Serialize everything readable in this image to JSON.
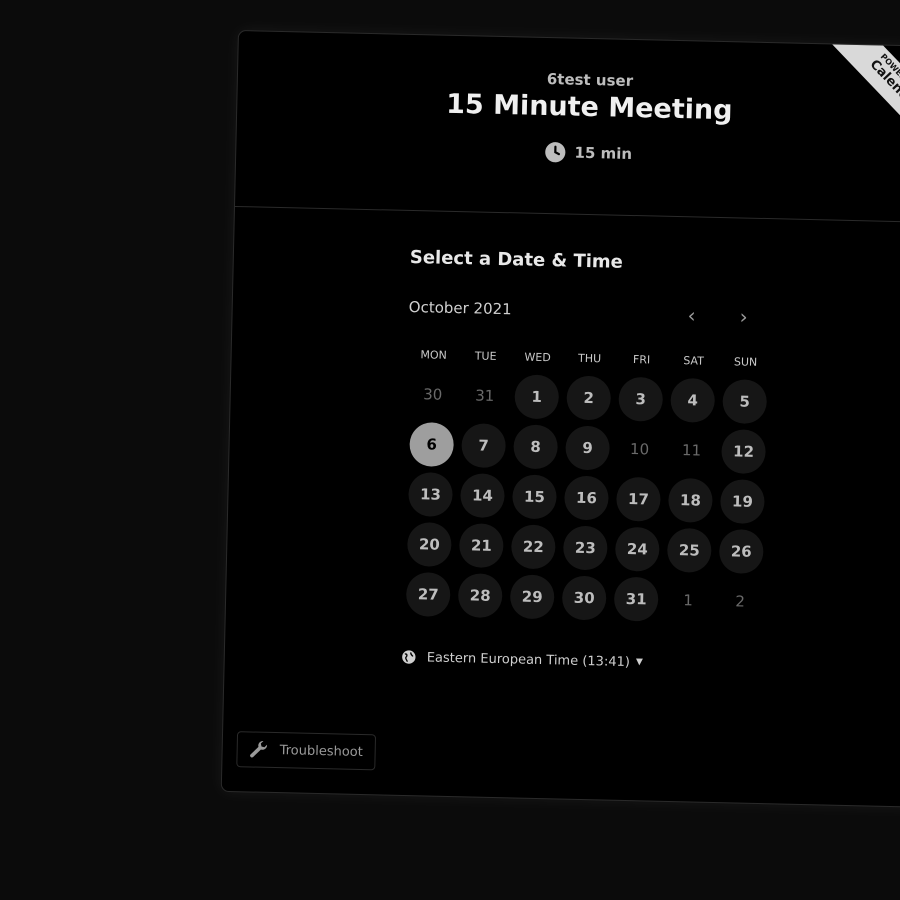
{
  "header": {
    "host_name": "6test user",
    "meeting_title": "15 Minute Meeting",
    "duration": "15 min",
    "duration_icon": "clock-icon"
  },
  "ribbon": {
    "small_text": "POWERED BY",
    "big_text": "Calendly"
  },
  "scheduler": {
    "section_title": "Select a Date & Time",
    "month_label": "October 2021",
    "prev_icon": "chevron-left-icon",
    "next_icon": "chevron-right-icon",
    "weekdays": [
      "MON",
      "TUE",
      "WED",
      "THU",
      "FRI",
      "SAT",
      "SUN"
    ],
    "days": [
      {
        "label": "30",
        "state": "unavailable"
      },
      {
        "label": "31",
        "state": "unavailable"
      },
      {
        "label": "1",
        "state": "available"
      },
      {
        "label": "2",
        "state": "available"
      },
      {
        "label": "3",
        "state": "available"
      },
      {
        "label": "4",
        "state": "available"
      },
      {
        "label": "5",
        "state": "available"
      },
      {
        "label": "6",
        "state": "selected"
      },
      {
        "label": "7",
        "state": "available"
      },
      {
        "label": "8",
        "state": "available"
      },
      {
        "label": "9",
        "state": "available"
      },
      {
        "label": "10",
        "state": "unavailable"
      },
      {
        "label": "11",
        "state": "unavailable"
      },
      {
        "label": "12",
        "state": "available"
      },
      {
        "label": "13",
        "state": "available"
      },
      {
        "label": "14",
        "state": "available"
      },
      {
        "label": "15",
        "state": "available"
      },
      {
        "label": "16",
        "state": "available"
      },
      {
        "label": "17",
        "state": "available"
      },
      {
        "label": "18",
        "state": "available"
      },
      {
        "label": "19",
        "state": "available"
      },
      {
        "label": "20",
        "state": "available"
      },
      {
        "label": "21",
        "state": "available"
      },
      {
        "label": "22",
        "state": "available"
      },
      {
        "label": "23",
        "state": "available"
      },
      {
        "label": "24",
        "state": "available"
      },
      {
        "label": "25",
        "state": "available"
      },
      {
        "label": "26",
        "state": "available"
      },
      {
        "label": "27",
        "state": "available"
      },
      {
        "label": "28",
        "state": "available"
      },
      {
        "label": "29",
        "state": "available"
      },
      {
        "label": "30",
        "state": "available"
      },
      {
        "label": "31",
        "state": "available"
      },
      {
        "label": "1",
        "state": "unavailable"
      },
      {
        "label": "2",
        "state": "unavailable"
      }
    ],
    "timezone": {
      "icon": "globe-icon",
      "label": "Eastern European Time (13:41)"
    }
  },
  "footer": {
    "troubleshoot_icon": "wrench-icon",
    "troubleshoot_label": "Troubleshoot"
  },
  "colors": {
    "background": "#000000",
    "day_available_bg": "#161616",
    "day_selected_bg": "#9e9e9e",
    "ribbon_bg": "#d9d9d9"
  }
}
